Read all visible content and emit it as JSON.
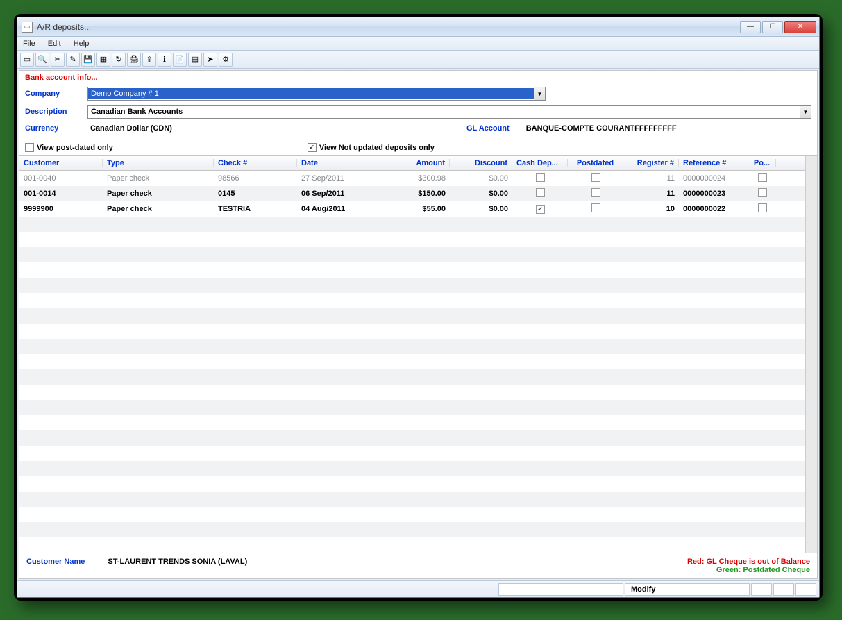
{
  "window": {
    "title": "A/R deposits..."
  },
  "menu": {
    "file": "File",
    "edit": "Edit",
    "help": "Help"
  },
  "section": {
    "bank_info": "Bank account info..."
  },
  "form": {
    "company_label": "Company",
    "company_value": "Demo Company # 1",
    "description_label": "Description",
    "description_value": "Canadian Bank Accounts",
    "currency_label": "Currency",
    "currency_value": "Canadian Dollar (CDN)",
    "gl_account_label": "GL Account",
    "gl_account_value": "BANQUE-COMPTE COURANTFFFFFFFFF",
    "view_postdated_label": "View post-dated only",
    "view_not_updated_label": "View Not updated deposits only"
  },
  "table": {
    "headers": {
      "customer": "Customer",
      "type": "Type",
      "check": "Check #",
      "date": "Date",
      "amount": "Amount",
      "discount": "Discount",
      "cashdep": "Cash Dep...",
      "postdated": "Postdated",
      "register": "Register #",
      "reference": "Reference #",
      "po": "Po..."
    },
    "rows": [
      {
        "customer": "001-0040",
        "type": "Paper check",
        "check": "98566",
        "date": "27 Sep/2011",
        "amount": "$300.98",
        "discount": "$0.00",
        "cashdep": false,
        "postdated": false,
        "register": "11",
        "reference": "0000000024",
        "po": false,
        "dim": true
      },
      {
        "customer": "001-0014",
        "type": "Paper check",
        "check": "0145",
        "date": "06 Sep/2011",
        "amount": "$150.00",
        "discount": "$0.00",
        "cashdep": false,
        "postdated": false,
        "register": "11",
        "reference": "0000000023",
        "po": false,
        "dim": false
      },
      {
        "customer": "9999900",
        "type": "Paper check",
        "check": "TESTRIA",
        "date": "04 Aug/2011",
        "amount": "$55.00",
        "discount": "$0.00",
        "cashdep": true,
        "postdated": false,
        "register": "10",
        "reference": "0000000022",
        "po": false,
        "dim": false
      }
    ]
  },
  "footer": {
    "customer_name_label": "Customer Name",
    "customer_name_value": "ST-LAURENT TRENDS SONIA (LAVAL)",
    "legend_red": "Red: GL Cheque is out of Balance",
    "legend_green": "Green: Postdated Cheque"
  },
  "status": {
    "modify": "Modify"
  }
}
